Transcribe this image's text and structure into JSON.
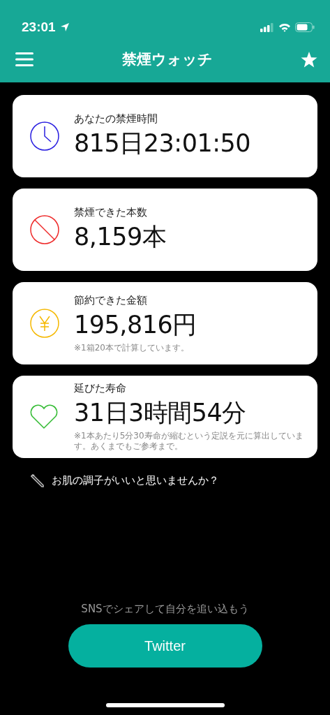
{
  "status_bar": {
    "time": "23:01"
  },
  "nav_bar": {
    "title": "禁煙ウォッチ"
  },
  "cards": [
    {
      "kind": "clock",
      "color": "#2a1fe0",
      "label": "あなたの禁煙時間",
      "value": "815日23:01:50"
    },
    {
      "kind": "ban",
      "color": "#ee2a2a",
      "label": "禁煙できた本数",
      "value": "8,159本"
    },
    {
      "kind": "yen",
      "color": "#f5b800",
      "label": "節約できた金額",
      "value": "195,816円",
      "note": "※1箱20本で計算しています。"
    },
    {
      "kind": "heart",
      "color": "#33bb33",
      "label": "延びた寿命",
      "value": "31日3時間54分",
      "note": "※1本あたり5分30寿命が縮むという定説を元に算出しています。あくまでもご参考まで。"
    }
  ],
  "tip": "お肌の調子がいいと思いませんか？",
  "share": {
    "caption": "SNSでシェアして自分を追い込もう",
    "button": "Twitter"
  }
}
